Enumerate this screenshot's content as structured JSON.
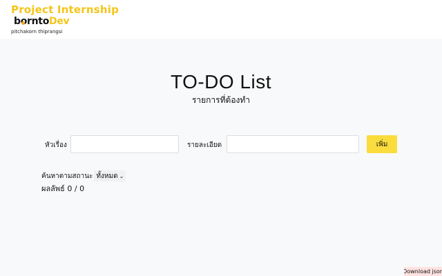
{
  "header": {
    "brand_title": "Project Internship",
    "logo_part1": "borntо",
    "logo_part2": "Dev",
    "author": "pitchakorn thiprangsi"
  },
  "main": {
    "title": "TO-DO List",
    "subtitle": "รายการที่ต้องทำ"
  },
  "form": {
    "topic_label": "หัวเรื่อง",
    "topic_value": "",
    "detail_label": "รายละเอียด",
    "detail_value": "",
    "add_label": "เพิ่ม"
  },
  "filter": {
    "label": "ค้นหาตามสถานะ",
    "selected": "ทั้งหมด",
    "result_label": "ผลลัพธ์",
    "result_value": "0 / 0"
  },
  "footer": {
    "download_label": "Download json"
  },
  "colors": {
    "brand": "#f5c518",
    "add_button": "#fbdc3d",
    "download_bg": "#fde2e1",
    "page_bg": "#f8f9fa"
  },
  "icons": {
    "select_chevron": "chevron-down-icon"
  }
}
